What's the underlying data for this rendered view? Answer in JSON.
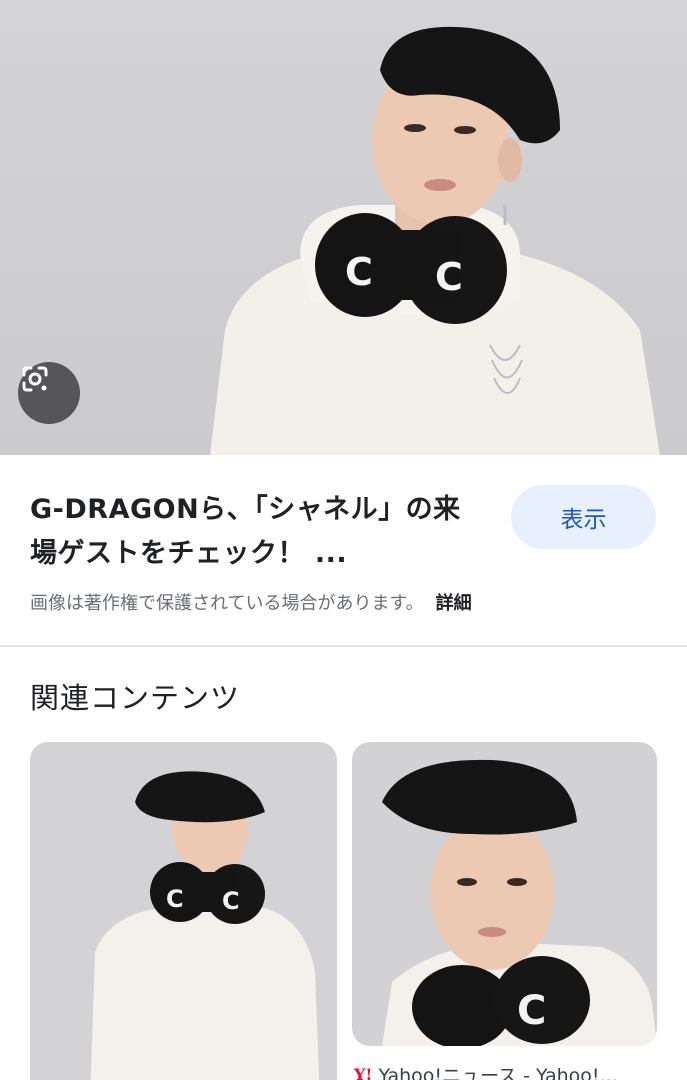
{
  "result": {
    "title": "G-DRAGONら、「シャネル」の来場ゲストをチェック！ ...",
    "show_button": "表示",
    "copyright_notice": "画像は著作権で保護されている場合があります。",
    "details_link": "詳細"
  },
  "related": {
    "heading": "関連コンテンツ",
    "items": [
      {
        "source": ""
      },
      {
        "source": "Yahoo!ニュース - Yahoo!..."
      }
    ]
  },
  "icons": {
    "lens": "google-lens-icon",
    "source_logo": "yahoo-logo-icon"
  },
  "colors": {
    "button_bg": "#e8f0fe",
    "button_text": "#1a56c8",
    "muted_text": "#6b6e72",
    "yahoo_red": "#ff0033"
  }
}
